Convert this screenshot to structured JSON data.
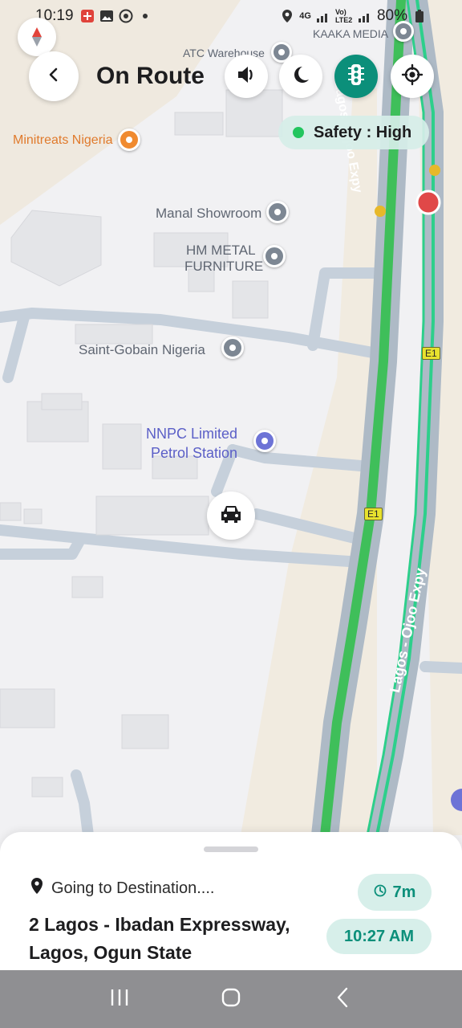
{
  "status_bar": {
    "time": "10:19",
    "battery": "80%",
    "network_label": "4G",
    "lte_label": "Vo) LTE2"
  },
  "header": {
    "title": "On Route"
  },
  "safety": {
    "label": "Safety : High",
    "color": "#22c55e"
  },
  "map": {
    "labels": {
      "atc_warehouse": "ATC Warehouse",
      "kaaka_media": "KAAKA MEDIA",
      "minitreats": "Minitreats Nigeria",
      "manal": "Manal Showroom",
      "hm_metal_1": "HM METAL",
      "hm_metal_2": "FURNITURE",
      "saint_gobain": "Saint-Gobain Nigeria",
      "nnpc_1": "NNPC Limited",
      "nnpc_2": "Petrol Station",
      "road_name_1": "Lagos - Ojoo Expy",
      "road_name_2": "Lagos - Ojoo Expy",
      "shield_1": "E1",
      "shield_2": "E1"
    }
  },
  "trip": {
    "going_label": "Going to Destination....",
    "destination": "2 Lagos - Ibadan Expressway, Lagos, Ogun State",
    "eta_minutes": "7m",
    "eta_time": "10:27 AM"
  },
  "colors": {
    "accent": "#0b8f7a",
    "route_green": "#3fbf5a",
    "pill_bg": "#d7efea"
  },
  "icons": {
    "back": "chevron-left-icon",
    "sound": "speaker-icon",
    "night": "moon-icon",
    "traffic": "traffic-light-icon",
    "locate": "crosshair-icon",
    "car": "car-icon",
    "pin": "location-pin-icon",
    "clock": "clock-icon"
  }
}
